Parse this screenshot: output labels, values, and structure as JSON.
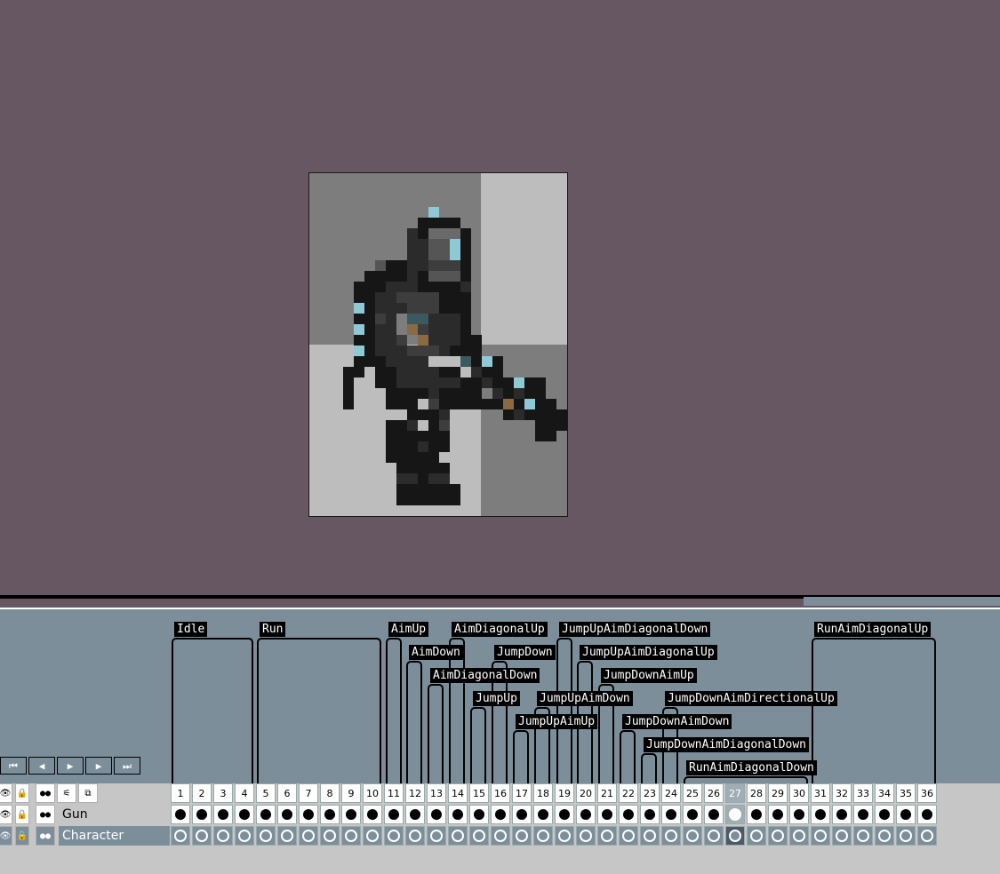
{
  "canvas": {
    "background_color": "#675763",
    "checker_colors": [
      "#7d7d7d",
      "#bdbdbd"
    ]
  },
  "timeline": {
    "background_color": "#7d8e9b",
    "tags": [
      {
        "label": "Idle"
      },
      {
        "label": "Run"
      },
      {
        "label": "AimUp"
      },
      {
        "label": "AimDiagonalUp"
      },
      {
        "label": "JumpUpAimDiagonalDown"
      },
      {
        "label": "RunAimDiagonalUp"
      },
      {
        "label": "AimDown"
      },
      {
        "label": "JumpDown"
      },
      {
        "label": "JumpUpAimDiagonalUp"
      },
      {
        "label": "AimDiagonalDown"
      },
      {
        "label": "JumpDownAimUp"
      },
      {
        "label": "JumpUp"
      },
      {
        "label": "JumpUpAimDown"
      },
      {
        "label": "JumpDownAimDirectionalUp"
      },
      {
        "label": "JumpUpAimUp"
      },
      {
        "label": "JumpDownAimDown"
      },
      {
        "label": "JumpDownAimDiagonalDown"
      },
      {
        "label": "RunAimDiagonalDown"
      }
    ],
    "playback": [
      {
        "icon": "first-frame-icon",
        "glyph": "⏮"
      },
      {
        "icon": "previous-frame-icon",
        "glyph": "◀"
      },
      {
        "icon": "play-icon",
        "glyph": "▶"
      },
      {
        "icon": "next-frame-icon",
        "glyph": "▶"
      },
      {
        "icon": "last-frame-icon",
        "glyph": "⏭"
      }
    ],
    "header_icons": [
      {
        "icon": "eye-icon",
        "glyph": "👁"
      },
      {
        "icon": "lock-icon",
        "glyph": "🔒"
      },
      {
        "icon": "link-icon",
        "glyph": "●●"
      },
      {
        "icon": "layers-icon",
        "glyph": "⚟"
      },
      {
        "icon": "onion-skin-icon",
        "glyph": "⧉"
      }
    ],
    "frames": [
      "1",
      "2",
      "3",
      "4",
      "5",
      "6",
      "7",
      "8",
      "9",
      "10",
      "11",
      "12",
      "13",
      "14",
      "15",
      "16",
      "17",
      "18",
      "19",
      "20",
      "21",
      "22",
      "23",
      "24",
      "25",
      "26",
      "27",
      "28",
      "29",
      "30",
      "31",
      "32",
      "33",
      "34",
      "35",
      "36"
    ],
    "active_frame": 27,
    "layers": [
      {
        "name": "Gun",
        "cel_style": "full",
        "selected": false
      },
      {
        "name": "Character",
        "cel_style": "empty",
        "selected": true
      }
    ]
  }
}
